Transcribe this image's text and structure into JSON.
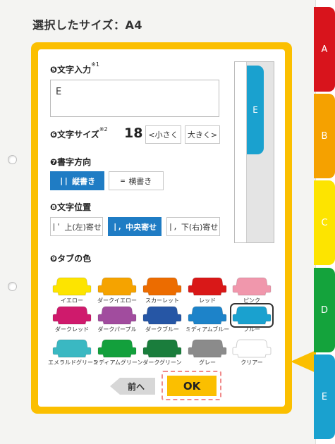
{
  "page": {
    "title": "選択したサイズ：A4"
  },
  "text_input": {
    "label": "❺文字入力",
    "note": "※1",
    "value": "E"
  },
  "font_size": {
    "label": "❻文字サイズ",
    "note": "※2",
    "value": "18",
    "smaller": "<小さく",
    "larger": "大きく>"
  },
  "direction": {
    "label": "❼書字方向",
    "options": [
      {
        "label": "縦書き",
        "icon": "||",
        "selected": true
      },
      {
        "label": "横書き",
        "icon": "=",
        "selected": false
      }
    ]
  },
  "position": {
    "label": "❽文字位置",
    "options": [
      {
        "label": "上(左)寄せ",
        "icon": "|'",
        "selected": false
      },
      {
        "label": "中央寄せ",
        "icon": "|,",
        "selected": true
      },
      {
        "label": "下(右)寄せ",
        "icon": "|,",
        "selected": false
      }
    ]
  },
  "tab_color": {
    "label": "❾タブの色",
    "swatches": [
      {
        "name": "イエロー",
        "color": "#fde400",
        "selected": false
      },
      {
        "name": "ダークイエロー",
        "color": "#f5a300",
        "selected": false
      },
      {
        "name": "スカーレット",
        "color": "#ec6c00",
        "selected": false
      },
      {
        "name": "レッド",
        "color": "#d91818",
        "selected": false
      },
      {
        "name": "ピンク",
        "color": "#f097ac",
        "selected": false
      },
      {
        "name": "ダークレッド",
        "color": "#cf1a6c",
        "selected": false
      },
      {
        "name": "ダークパープル",
        "color": "#a14c9e",
        "selected": false
      },
      {
        "name": "ダークブルー",
        "color": "#2656a5",
        "selected": false
      },
      {
        "name": "ミディアムブルー",
        "color": "#1d83c9",
        "selected": false
      },
      {
        "name": "ブルー",
        "color": "#1aa1cf",
        "selected": true
      },
      {
        "name": "エメラルドグリーン",
        "color": "#3ab8c2",
        "selected": false
      },
      {
        "name": "ミディアムグリーン",
        "color": "#13a03c",
        "selected": false
      },
      {
        "name": "ダークグリーン",
        "color": "#1a7d3c",
        "selected": false
      },
      {
        "name": "グレー",
        "color": "#8b8b8b",
        "selected": false
      },
      {
        "name": "クリアー",
        "color": "#ffffff",
        "selected": false
      }
    ]
  },
  "preview": {
    "tab_label": "E",
    "tab_color": "#1aa1cf"
  },
  "actions": {
    "prev": "前へ",
    "ok": "OK"
  },
  "index_tabs": [
    {
      "label": "A",
      "color": "#d8141c"
    },
    {
      "label": "B",
      "color": "#f5a100"
    },
    {
      "label": "C",
      "color": "#fde400"
    },
    {
      "label": "D",
      "color": "#14a33c"
    },
    {
      "label": "E",
      "color": "#1aa1cf"
    }
  ],
  "colors": {
    "frame": "#fbbf00",
    "active_button": "#1f7cc4"
  }
}
